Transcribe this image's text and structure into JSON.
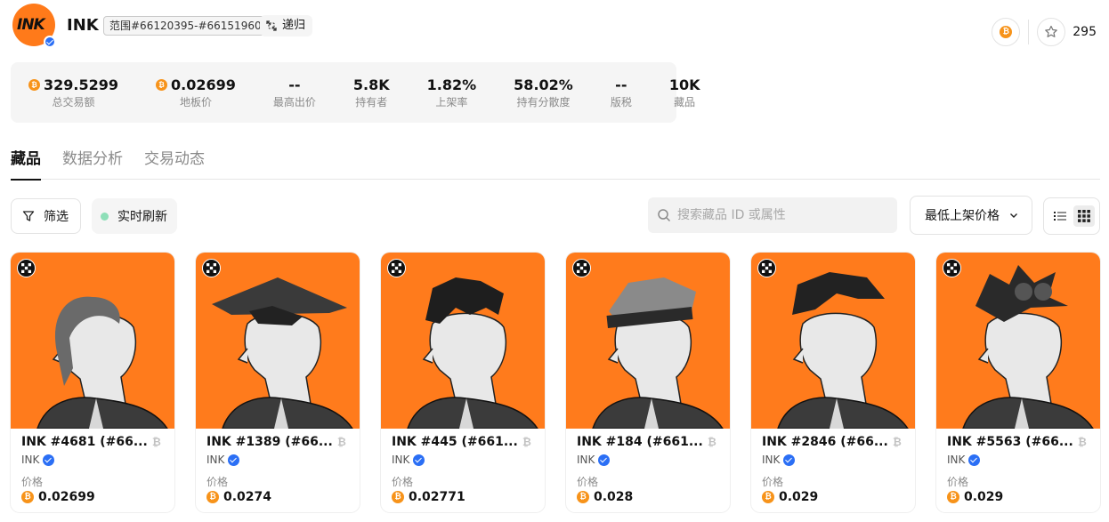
{
  "header": {
    "logo_text": "INK",
    "collection_name": "INK",
    "range": "范围#66120395-#66151960",
    "recursive_label": "递归",
    "favorite_count": "295"
  },
  "stats": [
    {
      "value": "329.5299",
      "label": "总交易额",
      "btc": true
    },
    {
      "value": "0.02699",
      "label": "地板价",
      "btc": true
    },
    {
      "value": "--",
      "label": "最高出价",
      "btc": false
    },
    {
      "value": "5.8K",
      "label": "持有者",
      "btc": false
    },
    {
      "value": "1.82%",
      "label": "上架率",
      "btc": false
    },
    {
      "value": "58.02%",
      "label": "持有分散度",
      "btc": false
    },
    {
      "value": "--",
      "label": "版税",
      "btc": false
    },
    {
      "value": "10K",
      "label": "藏品",
      "btc": false
    }
  ],
  "tabs": [
    {
      "label": "藏品",
      "active": true
    },
    {
      "label": "数据分析",
      "active": false
    },
    {
      "label": "交易动态",
      "active": false
    }
  ],
  "toolbar": {
    "filter_label": "筛选",
    "live_label": "实时刷新",
    "search_placeholder": "搜索藏品 ID 或属性",
    "sort_label": "最低上架价格"
  },
  "cards": [
    {
      "title": "INK #4681 (#66...",
      "collection": "INK",
      "price_label": "价格",
      "price": "0.02699"
    },
    {
      "title": "INK #1389 (#66...",
      "collection": "INK",
      "price_label": "价格",
      "price": "0.0274"
    },
    {
      "title": "INK #445 (#661...",
      "collection": "INK",
      "price_label": "价格",
      "price": "0.02771"
    },
    {
      "title": "INK #184 (#661...",
      "collection": "INK",
      "price_label": "价格",
      "price": "0.028"
    },
    {
      "title": "INK #2846 (#66...",
      "collection": "INK",
      "price_label": "价格",
      "price": "0.029"
    },
    {
      "title": "INK #5563 (#66...",
      "collection": "INK",
      "price_label": "价格",
      "price": "0.029"
    }
  ],
  "colors": {
    "nft_background": "#ff7b1c",
    "bitcoin": "#f7931a",
    "verified": "#2b6ff5",
    "live_dot": "#8edfb8"
  },
  "icons": [
    "bitcoin-icon",
    "star-icon",
    "recursive-icon",
    "filter-icon",
    "search-icon",
    "chevron-down-icon",
    "list-view-icon",
    "grid-view-icon",
    "okx-icon",
    "verified-icon"
  ]
}
